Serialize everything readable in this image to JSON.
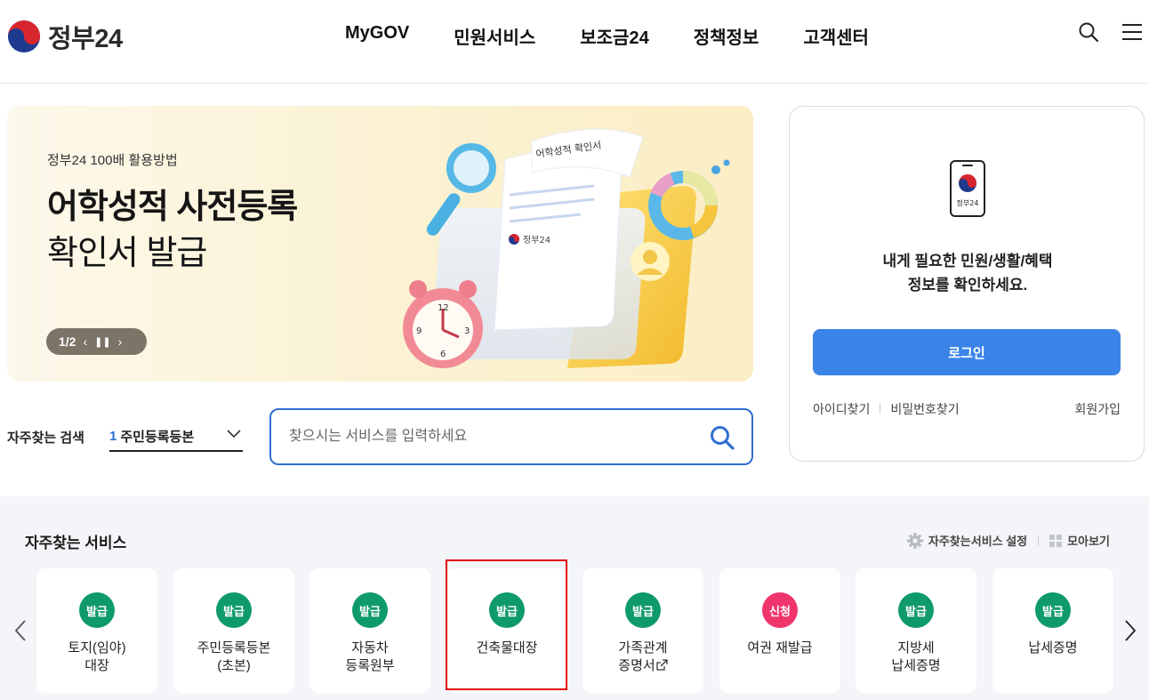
{
  "header": {
    "logo_text": "정부24",
    "nav": [
      "MyGOV",
      "민원서비스",
      "보조금24",
      "정책정보",
      "고객센터"
    ],
    "icons": [
      "search-icon",
      "menu-icon"
    ]
  },
  "banner": {
    "subtitle": "정부24 100배 활용방법",
    "title_line1": "어학성적 사전등록",
    "title_line2": "확인서 발급",
    "pager": "1/2",
    "doc_title": "어학성적 확인서",
    "doc_logo": "정부24"
  },
  "login": {
    "phone_label": "정부24",
    "message_line1": "내게 필요한 민원/생활/혜택",
    "message_line2": "정보를 확인하세요.",
    "button": "로그인",
    "find_id": "아이디찾기",
    "find_pw": "비밀번호찾기",
    "signup": "회원가입"
  },
  "search": {
    "freq_label": "자주찾는 검색",
    "freq_rank": "1",
    "freq_value": "주민등록등본",
    "placeholder": "찾으시는 서비스를 입력하세요"
  },
  "services": {
    "title": "자주찾는 서비스",
    "settings": "자주찾는서비스 설정",
    "view_all": "모아보기",
    "colors": {
      "issue": "#0f9a6a",
      "apply": "#f0346c",
      "primary": "#3a84e8"
    },
    "items": [
      {
        "badge": "발급",
        "type": "issue",
        "line1": "토지(임야)",
        "line2": "대장"
      },
      {
        "badge": "발급",
        "type": "issue",
        "line1": "주민등록등본",
        "line2": "(초본)"
      },
      {
        "badge": "발급",
        "type": "issue",
        "line1": "자동차",
        "line2": "등록원부"
      },
      {
        "badge": "발급",
        "type": "issue",
        "line1": "건축물대장",
        "line2": ""
      },
      {
        "badge": "발급",
        "type": "issue",
        "line1": "가족관계",
        "line2": "증명서"
      },
      {
        "badge": "신청",
        "type": "apply",
        "line1": "여권 재발급",
        "line2": ""
      },
      {
        "badge": "발급",
        "type": "issue",
        "line1": "지방세",
        "line2": "납세증명"
      },
      {
        "badge": "발급",
        "type": "issue",
        "line1": "납세증명",
        "line2": ""
      }
    ]
  }
}
